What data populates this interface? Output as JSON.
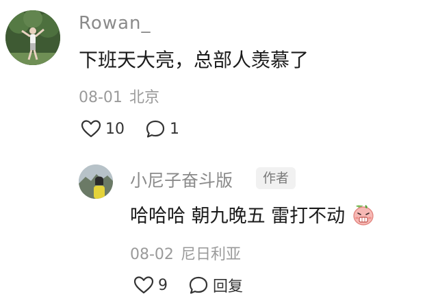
{
  "comment": {
    "username": "Rowan_",
    "text": "下班天大亮，总部人羡慕了",
    "date": "08-01",
    "location": "北京",
    "like_count": "10",
    "reply_count": "1"
  },
  "reply": {
    "username": "小尼子奋斗版",
    "badge": "作者",
    "text": "哈哈哈 朝九晚五 雷打不动",
    "date": "08-02",
    "location": "尼日利亚",
    "like_count": "9",
    "reply_label": "回复"
  },
  "icons": {
    "like": "heart-icon",
    "comment": "speech-bubble-icon",
    "emoji": "peach-face-emoji"
  },
  "colors": {
    "secondary_text": "#8a8a8a",
    "meta_text": "#9a9a9a",
    "badge_bg": "#f1f1f1"
  }
}
